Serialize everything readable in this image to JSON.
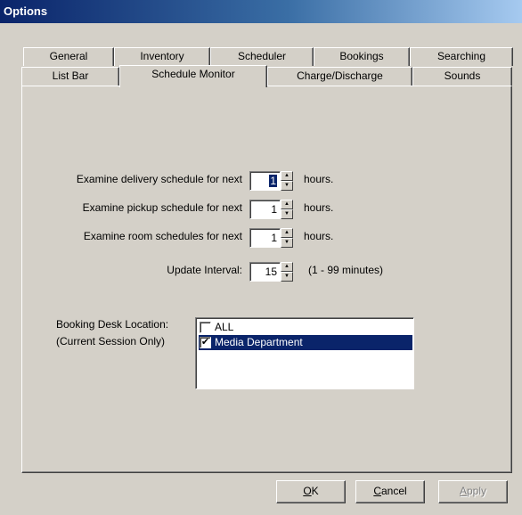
{
  "window": {
    "title": "Options"
  },
  "tabs_back": [
    "General",
    "Inventory",
    "Scheduler",
    "Bookings",
    "Searching"
  ],
  "tabs_front": [
    "List Bar",
    "Schedule Monitor",
    "Charge/Discharge",
    "Sounds"
  ],
  "active_tab": "Schedule Monitor",
  "fields": {
    "delivery": {
      "label": "Examine delivery schedule for next",
      "value": "1",
      "unit": "hours."
    },
    "pickup": {
      "label": "Examine pickup schedule for next",
      "value": "1",
      "unit": "hours."
    },
    "room": {
      "label": "Examine room schedules for next",
      "value": "1",
      "unit": "hours."
    },
    "interval": {
      "label": "Update Interval:",
      "value": "15",
      "unit": "(1 - 99 minutes)"
    }
  },
  "location": {
    "label_line1": "Booking Desk Location:",
    "label_line2": "(Current Session Only)",
    "items": [
      {
        "label": "ALL",
        "checked": false,
        "selected": false
      },
      {
        "label": "Media Department",
        "checked": true,
        "selected": true
      }
    ]
  },
  "buttons": {
    "ok_mnemonic": "O",
    "ok_rest": "K",
    "cancel_mnemonic": "C",
    "cancel_rest": "ancel",
    "apply_mnemonic": "A",
    "apply_rest": "pply"
  }
}
